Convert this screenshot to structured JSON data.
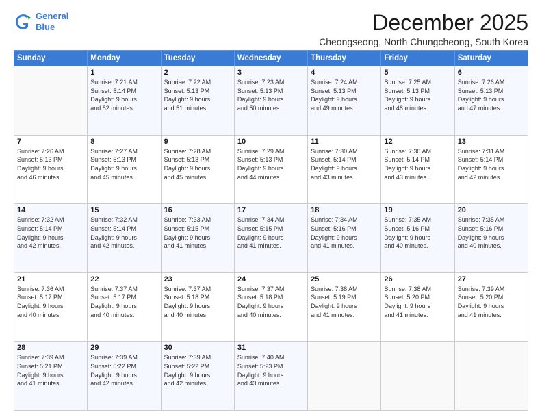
{
  "logo": {
    "line1": "General",
    "line2": "Blue"
  },
  "title": "December 2025",
  "subtitle": "Cheongseong, North Chungcheong, South Korea",
  "weekdays": [
    "Sunday",
    "Monday",
    "Tuesday",
    "Wednesday",
    "Thursday",
    "Friday",
    "Saturday"
  ],
  "weeks": [
    [
      {
        "day": "",
        "info": ""
      },
      {
        "day": "1",
        "info": "Sunrise: 7:21 AM\nSunset: 5:14 PM\nDaylight: 9 hours\nand 52 minutes."
      },
      {
        "day": "2",
        "info": "Sunrise: 7:22 AM\nSunset: 5:13 PM\nDaylight: 9 hours\nand 51 minutes."
      },
      {
        "day": "3",
        "info": "Sunrise: 7:23 AM\nSunset: 5:13 PM\nDaylight: 9 hours\nand 50 minutes."
      },
      {
        "day": "4",
        "info": "Sunrise: 7:24 AM\nSunset: 5:13 PM\nDaylight: 9 hours\nand 49 minutes."
      },
      {
        "day": "5",
        "info": "Sunrise: 7:25 AM\nSunset: 5:13 PM\nDaylight: 9 hours\nand 48 minutes."
      },
      {
        "day": "6",
        "info": "Sunrise: 7:26 AM\nSunset: 5:13 PM\nDaylight: 9 hours\nand 47 minutes."
      }
    ],
    [
      {
        "day": "7",
        "info": "Sunrise: 7:26 AM\nSunset: 5:13 PM\nDaylight: 9 hours\nand 46 minutes."
      },
      {
        "day": "8",
        "info": "Sunrise: 7:27 AM\nSunset: 5:13 PM\nDaylight: 9 hours\nand 45 minutes."
      },
      {
        "day": "9",
        "info": "Sunrise: 7:28 AM\nSunset: 5:13 PM\nDaylight: 9 hours\nand 45 minutes."
      },
      {
        "day": "10",
        "info": "Sunrise: 7:29 AM\nSunset: 5:13 PM\nDaylight: 9 hours\nand 44 minutes."
      },
      {
        "day": "11",
        "info": "Sunrise: 7:30 AM\nSunset: 5:14 PM\nDaylight: 9 hours\nand 43 minutes."
      },
      {
        "day": "12",
        "info": "Sunrise: 7:30 AM\nSunset: 5:14 PM\nDaylight: 9 hours\nand 43 minutes."
      },
      {
        "day": "13",
        "info": "Sunrise: 7:31 AM\nSunset: 5:14 PM\nDaylight: 9 hours\nand 42 minutes."
      }
    ],
    [
      {
        "day": "14",
        "info": "Sunrise: 7:32 AM\nSunset: 5:14 PM\nDaylight: 9 hours\nand 42 minutes."
      },
      {
        "day": "15",
        "info": "Sunrise: 7:32 AM\nSunset: 5:14 PM\nDaylight: 9 hours\nand 42 minutes."
      },
      {
        "day": "16",
        "info": "Sunrise: 7:33 AM\nSunset: 5:15 PM\nDaylight: 9 hours\nand 41 minutes."
      },
      {
        "day": "17",
        "info": "Sunrise: 7:34 AM\nSunset: 5:15 PM\nDaylight: 9 hours\nand 41 minutes."
      },
      {
        "day": "18",
        "info": "Sunrise: 7:34 AM\nSunset: 5:16 PM\nDaylight: 9 hours\nand 41 minutes."
      },
      {
        "day": "19",
        "info": "Sunrise: 7:35 AM\nSunset: 5:16 PM\nDaylight: 9 hours\nand 40 minutes."
      },
      {
        "day": "20",
        "info": "Sunrise: 7:35 AM\nSunset: 5:16 PM\nDaylight: 9 hours\nand 40 minutes."
      }
    ],
    [
      {
        "day": "21",
        "info": "Sunrise: 7:36 AM\nSunset: 5:17 PM\nDaylight: 9 hours\nand 40 minutes."
      },
      {
        "day": "22",
        "info": "Sunrise: 7:37 AM\nSunset: 5:17 PM\nDaylight: 9 hours\nand 40 minutes."
      },
      {
        "day": "23",
        "info": "Sunrise: 7:37 AM\nSunset: 5:18 PM\nDaylight: 9 hours\nand 40 minutes."
      },
      {
        "day": "24",
        "info": "Sunrise: 7:37 AM\nSunset: 5:18 PM\nDaylight: 9 hours\nand 40 minutes."
      },
      {
        "day": "25",
        "info": "Sunrise: 7:38 AM\nSunset: 5:19 PM\nDaylight: 9 hours\nand 41 minutes."
      },
      {
        "day": "26",
        "info": "Sunrise: 7:38 AM\nSunset: 5:20 PM\nDaylight: 9 hours\nand 41 minutes."
      },
      {
        "day": "27",
        "info": "Sunrise: 7:39 AM\nSunset: 5:20 PM\nDaylight: 9 hours\nand 41 minutes."
      }
    ],
    [
      {
        "day": "28",
        "info": "Sunrise: 7:39 AM\nSunset: 5:21 PM\nDaylight: 9 hours\nand 41 minutes."
      },
      {
        "day": "29",
        "info": "Sunrise: 7:39 AM\nSunset: 5:22 PM\nDaylight: 9 hours\nand 42 minutes."
      },
      {
        "day": "30",
        "info": "Sunrise: 7:39 AM\nSunset: 5:22 PM\nDaylight: 9 hours\nand 42 minutes."
      },
      {
        "day": "31",
        "info": "Sunrise: 7:40 AM\nSunset: 5:23 PM\nDaylight: 9 hours\nand 43 minutes."
      },
      {
        "day": "",
        "info": ""
      },
      {
        "day": "",
        "info": ""
      },
      {
        "day": "",
        "info": ""
      }
    ]
  ]
}
